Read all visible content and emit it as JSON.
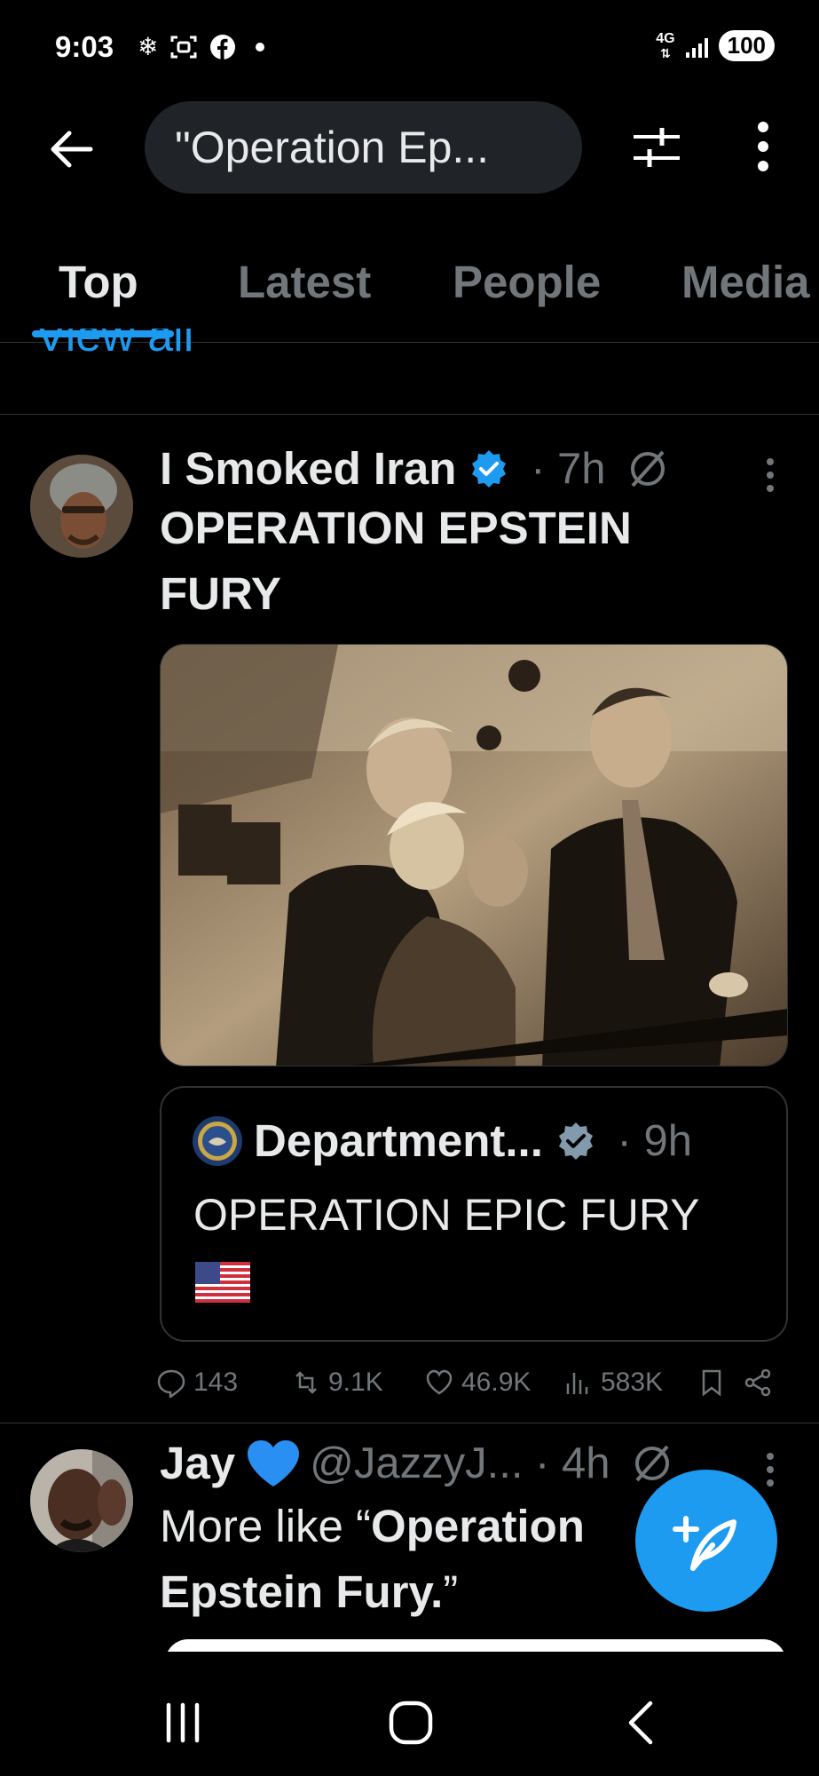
{
  "status_bar": {
    "time": "9:03",
    "network": "4G",
    "battery": "100"
  },
  "search": {
    "query": "\"Operation Ep..."
  },
  "tabs": [
    {
      "label": "Top",
      "active": true
    },
    {
      "label": "Latest",
      "active": false
    },
    {
      "label": "People",
      "active": false
    },
    {
      "label": "Media",
      "active": false
    }
  ],
  "view_all_label": "View all",
  "tweets": [
    {
      "name": "I Smoked Iran",
      "verified": true,
      "time": "7h",
      "text_lines": [
        "OPERATION EPSTEIN",
        "FURY"
      ],
      "has_media": true,
      "quote": {
        "name": "Department...",
        "verified": true,
        "time": "9h",
        "text": "OPERATION EPIC FURY",
        "flag": "us-flag"
      },
      "stats": {
        "replies": "143",
        "reposts": "9.1K",
        "likes": "46.9K",
        "views": "583K"
      }
    },
    {
      "name": "Jay",
      "handle": "@JazzyJ...",
      "time": "4h",
      "text_line1_pre": "More like “",
      "text_line1_bold": "Operation",
      "text_line2_bold": "Epstein Fury.",
      "text_line2_post": "”"
    }
  ],
  "colors": {
    "accent": "#1d9bf0",
    "background": "#000000",
    "muted": "#71767b",
    "text": "#e7e9ea"
  }
}
